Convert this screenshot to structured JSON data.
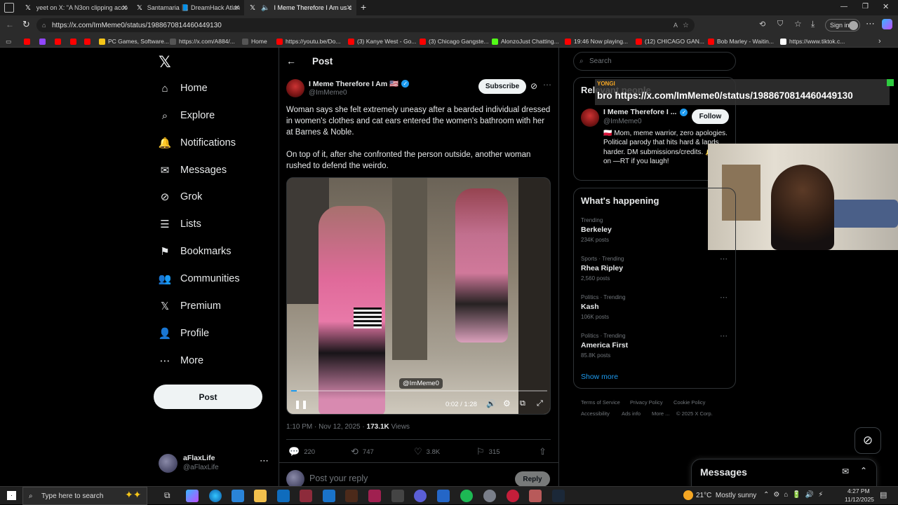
{
  "tabs": [
    {
      "title": "yeet on X: \"A N3on clipping acco",
      "icon": "x-logo-icon"
    },
    {
      "title": "Santamaria 📘 DreamHack Atlan",
      "icon": "x-logo-icon"
    },
    {
      "title": "I Meme Therefore I Am us c",
      "icon": "x-logo-icon"
    }
  ],
  "address": {
    "url": "https://x.com/ImMeme0/status/1988670814460449130"
  },
  "signin": "Sign in",
  "bookmarks": [
    {
      "label": "PC Games, Software...",
      "color": "#f5c518"
    },
    {
      "label": "https://x.com/A884/...",
      "color": "#ffffff"
    },
    {
      "label": "Home",
      "color": "#ffffff"
    },
    {
      "label": "https://youtu.be/Do...",
      "color": "#ff0000"
    },
    {
      "label": "(3) Kanye West - Go...",
      "color": "#ff0000"
    },
    {
      "label": "(3) Chicago Gangste...",
      "color": "#ff0000"
    },
    {
      "label": "AlonzoJust Chatting...",
      "color": "#53fc18"
    },
    {
      "label": "19:46 Now playing...",
      "color": "#ff0000"
    },
    {
      "label": "(12) CHICAGO GAN...",
      "color": "#ff0000"
    },
    {
      "label": "Bob Marley - Waitin...",
      "color": "#ff0000"
    },
    {
      "label": "https://www.tiktok.c...",
      "color": "#ffffff"
    }
  ],
  "nav": [
    {
      "label": "Home",
      "icon": "home-icon",
      "glyph": "⌂"
    },
    {
      "label": "Explore",
      "icon": "search-icon",
      "glyph": "⌕"
    },
    {
      "label": "Notifications",
      "icon": "bell-icon",
      "glyph": "🔔"
    },
    {
      "label": "Messages",
      "icon": "mail-icon",
      "glyph": "✉"
    },
    {
      "label": "Grok",
      "icon": "grok-icon",
      "glyph": "⊘"
    },
    {
      "label": "Lists",
      "icon": "list-icon",
      "glyph": "☰"
    },
    {
      "label": "Bookmarks",
      "icon": "bookmark-icon",
      "glyph": "⚑"
    },
    {
      "label": "Communities",
      "icon": "people-icon",
      "glyph": "👥"
    },
    {
      "label": "Premium",
      "icon": "x-logo-icon",
      "glyph": "𝕏"
    },
    {
      "label": "Profile",
      "icon": "person-icon",
      "glyph": "👤"
    },
    {
      "label": "More",
      "icon": "more-circle-icon",
      "glyph": "⋯"
    }
  ],
  "post_button": "Post",
  "account": {
    "name": "aFlaxLife",
    "handle": "@aFlaxLife"
  },
  "header": {
    "title": "Post"
  },
  "tweet": {
    "author": "I Meme Therefore I Am 🇺🇸",
    "handle": "@ImMeme0",
    "subscribe": "Subscribe",
    "text1": "Woman says she felt extremely uneasy after a bearded individual dressed in women's clothes and cat ears entered the women's bathroom with her at Barnes & Noble.",
    "text2": "On top of it, after she confronted the person outside, another woman rushed to defend the weirdo.",
    "video_watermark": "@ImMeme0",
    "video_time": "0:02 / 1:28",
    "video_progress": 0.023,
    "timestamp": "1:10 PM · Nov 12, 2025",
    "views_count": "173.1K",
    "views_label": "Views",
    "replies": "220",
    "reposts": "747",
    "likes": "3.8K",
    "bookmarks": "315",
    "reply_placeholder": "Post your reply",
    "reply_button": "Reply"
  },
  "search": {
    "placeholder": "Search"
  },
  "relevant": {
    "title": "Relevant people",
    "name": "I Meme Therefore I ...",
    "handle": "@ImMeme0",
    "follow": "Follow",
    "bio": "🇵🇱 Mom, meme warrior, zero apologies. Political parody that hits hard & lands harder. DM submissions/credits. 🔔 Turn on —RT if you laugh!"
  },
  "overlay": {
    "tag": "YONGI",
    "text": "bro https://x.com/ImMeme0/status/1988670814460449130"
  },
  "happening": {
    "title": "What's happening",
    "trends": [
      {
        "category": "Trending",
        "name": "Berkeley",
        "count": "234K posts"
      },
      {
        "category": "Sports · Trending",
        "name": "Rhea Ripley",
        "count": "2,560 posts"
      },
      {
        "category": "Politics · Trending",
        "name": "Kash",
        "count": "106K posts"
      },
      {
        "category": "Politics · Trending",
        "name": "America First",
        "count": "85.8K posts"
      }
    ],
    "show_more": "Show more"
  },
  "footer": [
    "Terms of Service",
    "Privacy Policy",
    "Cookie Policy",
    "Accessibility",
    "Ads info",
    "More ...",
    "© 2025 X Corp."
  ],
  "messages_drawer": {
    "title": "Messages"
  },
  "taskbar": {
    "search_placeholder": "Type here to search",
    "weather": "21°C  Mostly sunny",
    "time": "4:27 PM",
    "date": "11/12/2025"
  }
}
